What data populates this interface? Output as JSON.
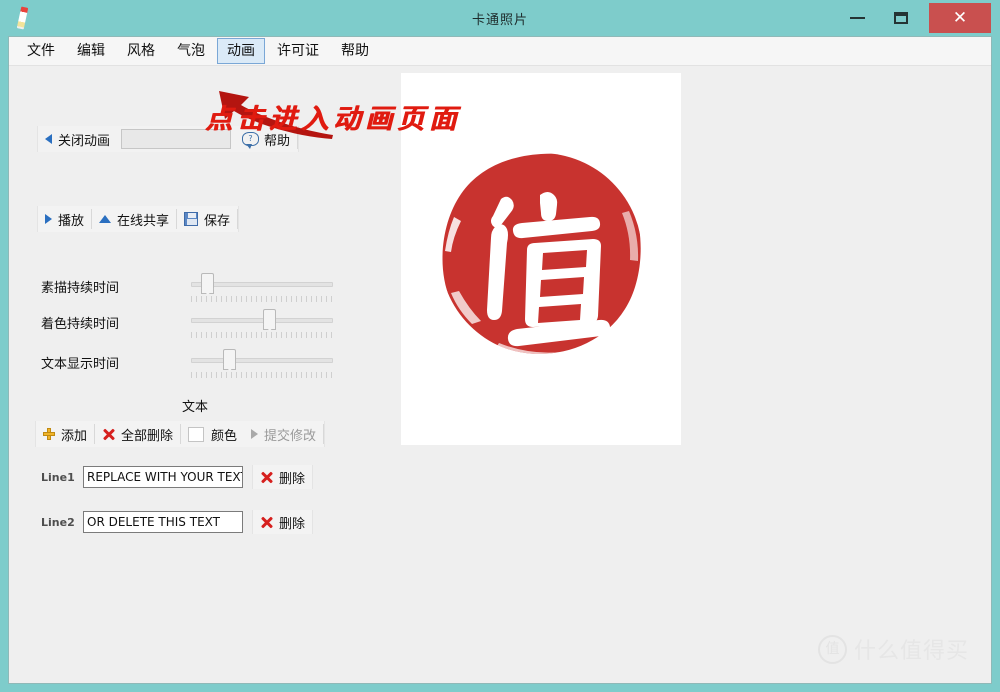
{
  "window": {
    "title": "卡通照片",
    "app_icon": "pencil-icon",
    "minimize_label": "",
    "maximize_label": "",
    "close_label": "✕",
    "frame_color": "#7ecccb",
    "close_button_color": "#c9504f",
    "body_color": "#efefef"
  },
  "menu": {
    "items": [
      {
        "label": "文件",
        "selected": false
      },
      {
        "label": "编辑",
        "selected": false
      },
      {
        "label": "风格",
        "selected": false
      },
      {
        "label": "气泡",
        "selected": false
      },
      {
        "label": "动画",
        "selected": true
      },
      {
        "label": "许可证",
        "selected": false
      },
      {
        "label": "帮助",
        "selected": false
      }
    ],
    "highlight_color": "#dbeaf7",
    "highlight_border": "#7aa7d6"
  },
  "annotation": {
    "text": "点击进入动画页面",
    "color": "#e01b10",
    "arrow": "red-arrow-icon"
  },
  "animation_toolbar": {
    "close_animation_label": "关闭动画",
    "close_animation_icon": "triangle-left-icon",
    "name_field_value": "",
    "name_field_placeholder": "",
    "help_label": "帮助",
    "help_icon": "help-bubble-icon"
  },
  "playback_toolbar": {
    "play_label": "播放",
    "play_icon": "play-triangle-icon",
    "share_label": "在线共享",
    "share_icon": "upload-triangle-icon",
    "save_label": "保存",
    "save_icon": "floppy-disk-icon"
  },
  "sliders": [
    {
      "label": "素描持续时间",
      "value": 8
    },
    {
      "label": "着色持续时间",
      "value": 56
    },
    {
      "label": "文本显示时间",
      "value": 25
    }
  ],
  "text_section": {
    "title": "文本",
    "add_label": "添加",
    "add_icon": "plus-icon",
    "delete_all_label": "全部删除",
    "delete_all_icon": "red-x-icon",
    "color_label": "颜色",
    "color_swatch": "#ffffff",
    "submit_label": "提交修改",
    "submit_icon": "triangle-right-icon",
    "lines": [
      {
        "label": "Line1",
        "value": "REPLACE WITH YOUR TEXT",
        "delete_label": "删除",
        "delete_icon": "red-x-icon"
      },
      {
        "label": "Line2",
        "value": "OR DELETE THIS TEXT",
        "delete_label": "删除",
        "delete_icon": "red-x-icon"
      }
    ]
  },
  "image_canvas": {
    "stamp_character": "值",
    "stamp_color": "#c8332f",
    "background": "#ffffff"
  },
  "watermark": {
    "logo_character": "值",
    "text": "什么值得买",
    "color": "#e6e6e6"
  }
}
